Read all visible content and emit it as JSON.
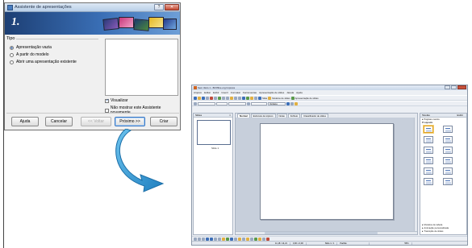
{
  "dialog": {
    "title": "Assistente de apresentações",
    "step_number": "1.",
    "type_label": "Tipo",
    "options": [
      {
        "label": "Apresentação vazia",
        "selected": true
      },
      {
        "label": "A partir do modelo",
        "selected": false
      },
      {
        "label": "Abrir uma apresentação existente",
        "selected": false
      }
    ],
    "checkboxes": [
      {
        "label": "Visualizar",
        "checked": true
      },
      {
        "label": "Não mostrar este Assistente novamente",
        "checked": false
      }
    ],
    "buttons": {
      "help": "Ajuda",
      "cancel": "Cancelar",
      "back": "<< Voltar",
      "next": "Próximo >>",
      "create": "Criar"
    }
  },
  "impress": {
    "title": "Sem título 1 - BrOffice.org Impress",
    "menu": [
      "Arquivo",
      "Editar",
      "Exibir",
      "Inserir",
      "Formatar",
      "Ferramentas",
      "Apresentação de slides",
      "Janela",
      "Ajuda"
    ],
    "toolbar_text": [
      "Slide",
      "Modelos de slides",
      "Apresentação de slides"
    ],
    "font_name": "Verdana",
    "slides_pane_title": "Slides",
    "slide_label": "Slide 1",
    "view_tabs": [
      "Normal",
      "Estrutura de tópicos",
      "Notas",
      "Folheto",
      "Classificador de slides"
    ],
    "tasks_title": "Tarefas",
    "tasks_view": "Exibir",
    "task_sections": [
      "Páginas mestre",
      "Layouts"
    ],
    "task_footer": [
      "Modelos de tabela",
      "Animação personalizada",
      "Transição de slides"
    ],
    "status": [
      "11,18 / 14,21",
      "0,00 x 0,00",
      "Slide 1 / 1",
      "Padrão",
      "55%"
    ]
  },
  "colors": {
    "banner": "#2b5797",
    "arrow": "#3aa0d8"
  }
}
